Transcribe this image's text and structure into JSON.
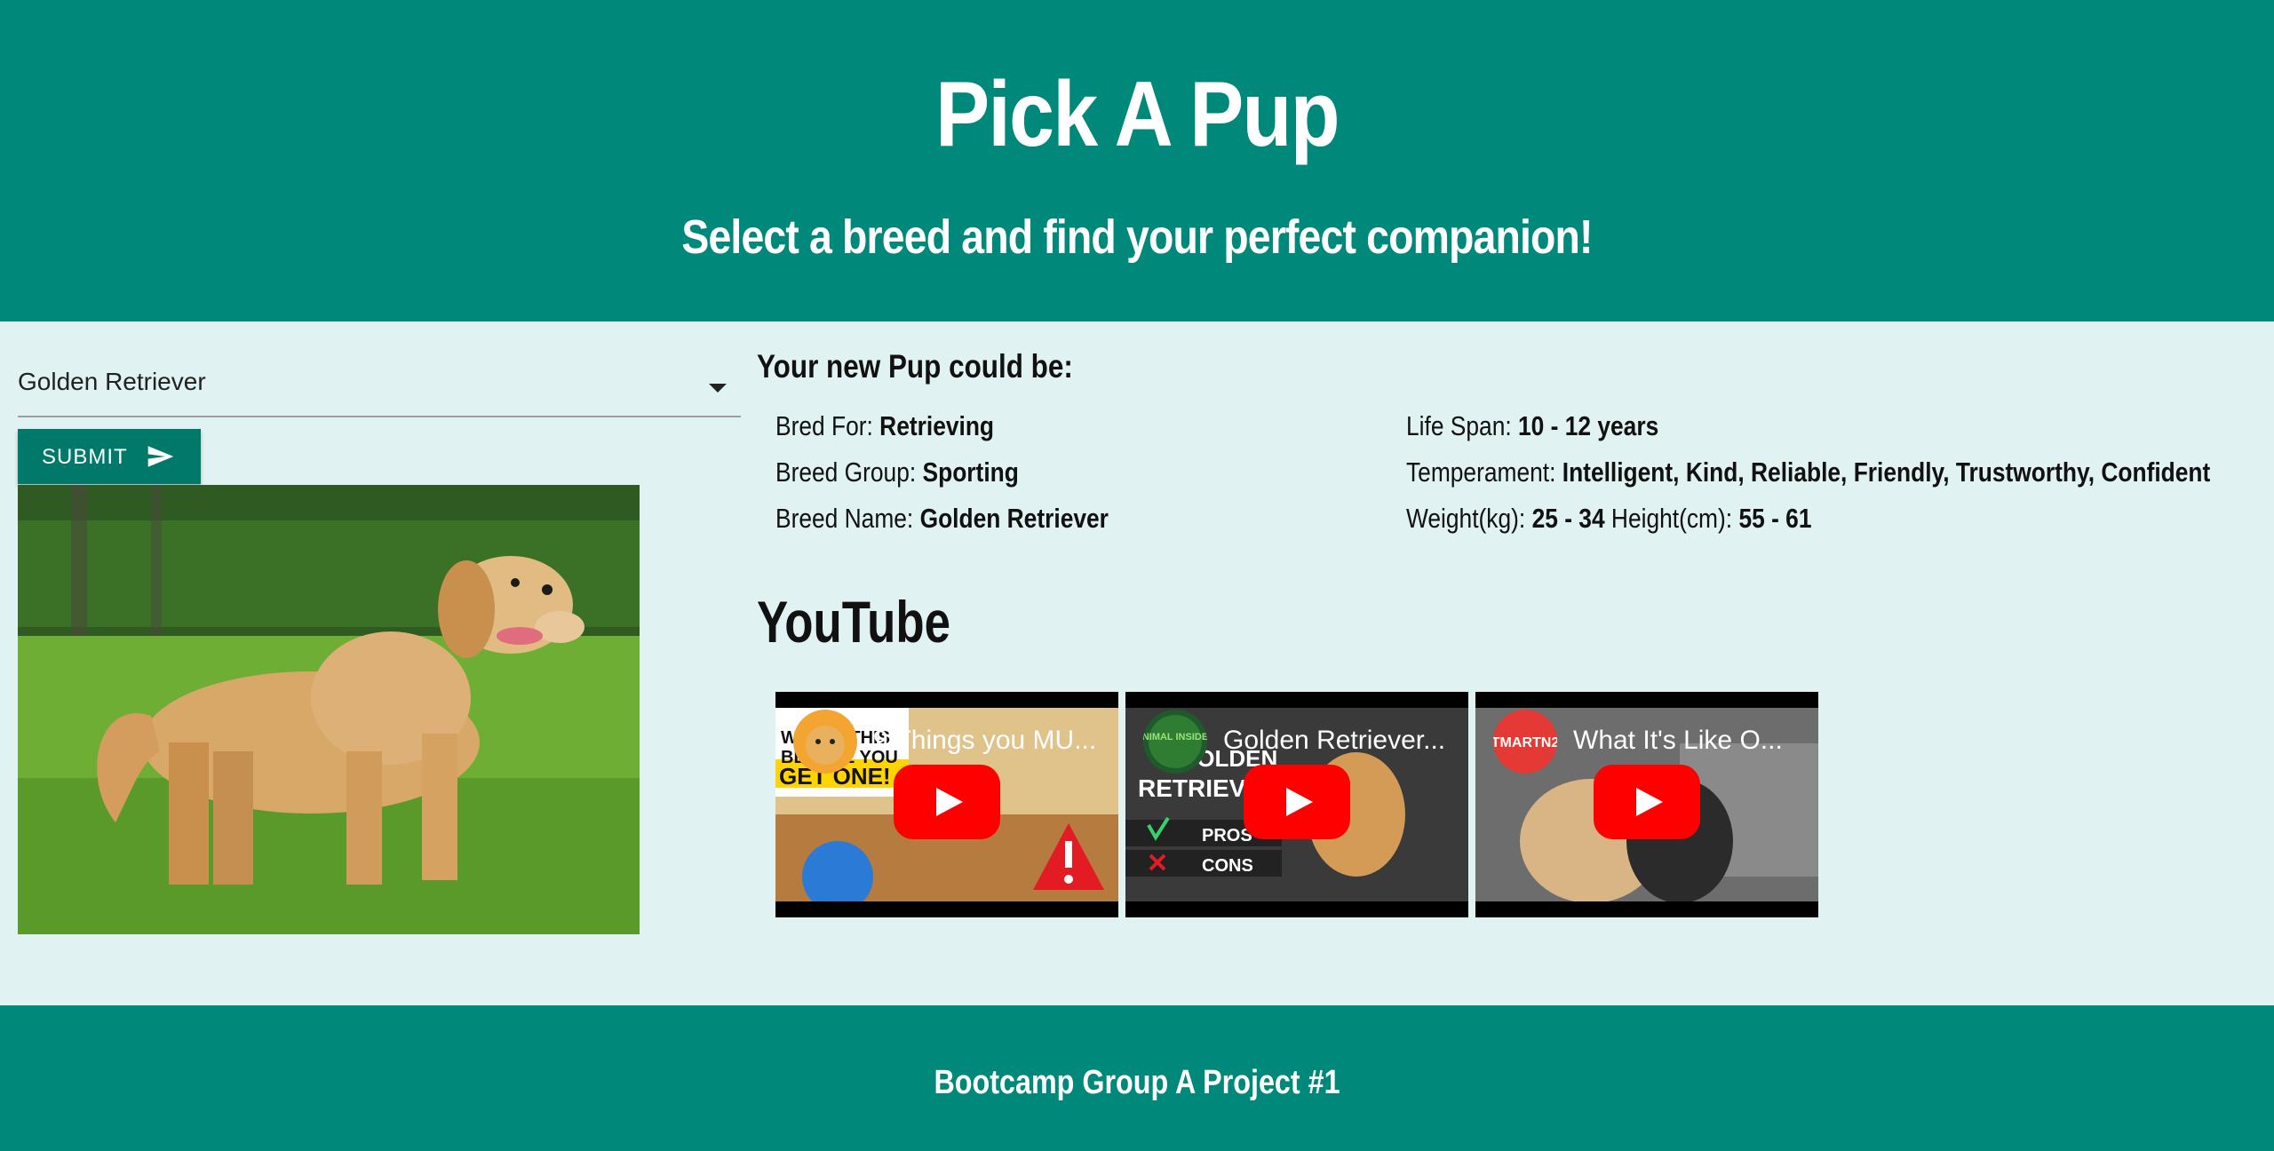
{
  "header": {
    "title": "Pick A Pup",
    "subtitle": "Select a breed and find your perfect companion!"
  },
  "breed_select": {
    "value": "Golden Retriever"
  },
  "submit": {
    "label": "SUBMIT",
    "icon": "send-icon"
  },
  "results": {
    "heading": "Your new Pup could be:",
    "bred_for": {
      "label": "Bred For:",
      "value": "Retrieving"
    },
    "breed_group": {
      "label": "Breed Group:",
      "value": "Sporting"
    },
    "breed_name": {
      "label": "Breed Name:",
      "value": "Golden Retriever"
    },
    "life_span": {
      "label": "Life Span:",
      "value": "10 - 12 years"
    },
    "temperament": {
      "label": "Temperament:",
      "value": "Intelligent, Kind, Reliable, Friendly, Trustworthy, Confident"
    },
    "weight": {
      "label": "Weight(kg):",
      "value": "25 - 34"
    },
    "height": {
      "label": "Height(cm):",
      "value": "55 - 61"
    }
  },
  "youtube": {
    "heading": "YouTube",
    "videos": [
      {
        "title": "9 Things you MU...",
        "overlay_top": "WATCH THIS",
        "overlay_mid": "BEFORE YOU",
        "overlay_bottom": "GET ONE!"
      },
      {
        "title": "Golden Retriever...",
        "overlay_top": "GOLDEN",
        "overlay_mid": "RETRIEVER",
        "pros": "PROS",
        "cons": "CONS",
        "channel": "ANIMAL INSIDER"
      },
      {
        "title": "What It's Like O...",
        "channel": "TMARTN2"
      }
    ]
  },
  "footer": {
    "text": "Bootcamp Group A Project #1"
  },
  "colors": {
    "primary": "#00897b",
    "button": "#00796b",
    "background": "#e0f2f1",
    "youtube_red": "#ff0000"
  }
}
